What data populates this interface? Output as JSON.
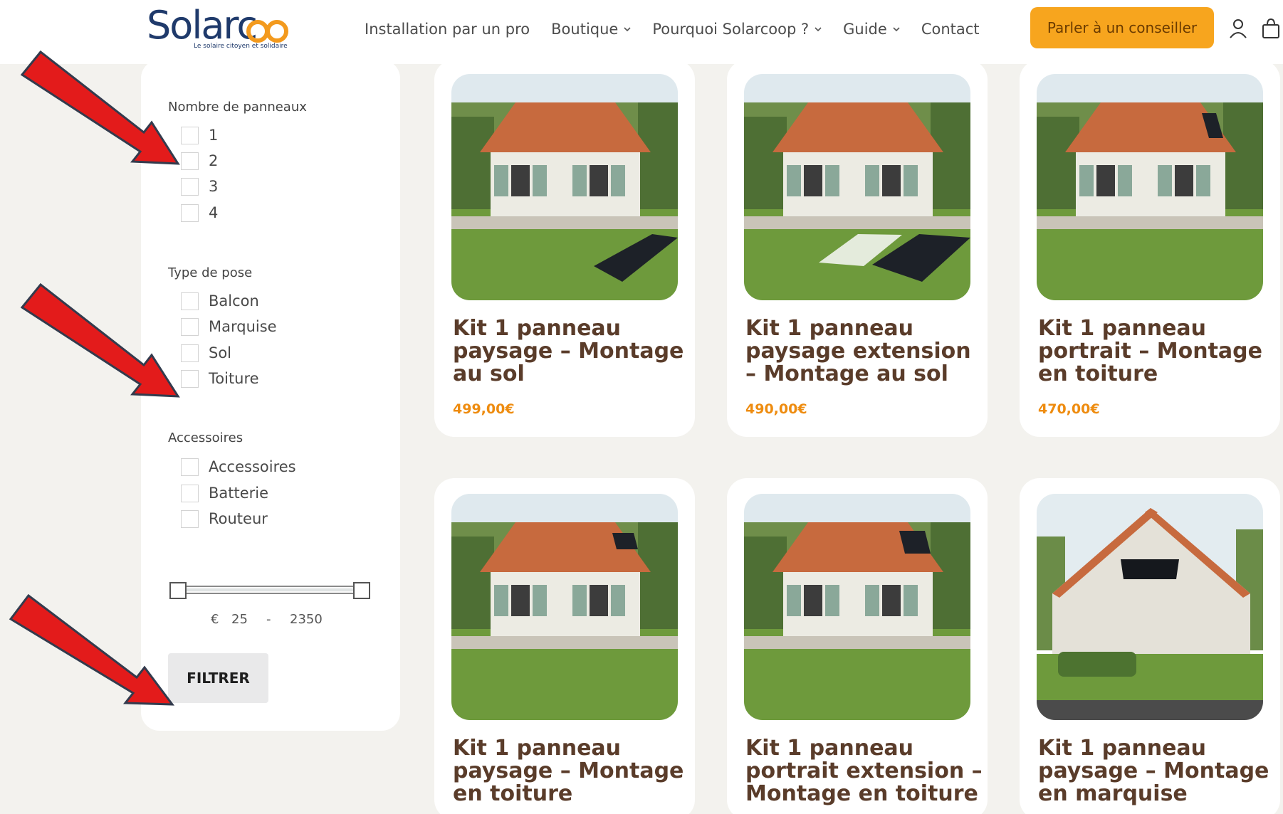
{
  "header": {
    "logo_text": "Solarcoop",
    "logo_tagline": "Le solaire citoyen et solidaire",
    "nav": [
      {
        "label": "Installation par un pro",
        "dropdown": false
      },
      {
        "label": "Boutique",
        "dropdown": true
      },
      {
        "label": "Pourquoi Solarcoop ?",
        "dropdown": true
      },
      {
        "label": "Guide",
        "dropdown": true
      },
      {
        "label": "Contact",
        "dropdown": false
      }
    ],
    "cta_label": "Parler à un conseiller",
    "icons": [
      "user-icon",
      "shopping-bag-icon"
    ],
    "accent_color": "#f7a51e"
  },
  "filters": {
    "panels": {
      "heading": "Nombre de panneaux",
      "options": [
        "1",
        "2",
        "3",
        "4"
      ]
    },
    "pose": {
      "heading": "Type de pose",
      "options": [
        "Balcon",
        "Marquise",
        "Sol",
        "Toiture"
      ]
    },
    "accessories": {
      "heading": "Accessoires",
      "options": [
        "Accessoires",
        "Batterie",
        "Routeur"
      ]
    },
    "price": {
      "currency": "€",
      "min": "25",
      "separator": "-",
      "max": "2350"
    },
    "button_label": "FILTRER"
  },
  "products": [
    {
      "title": "Kit 1 panneau paysage – Montage au sol",
      "price": "499,00€"
    },
    {
      "title": "Kit 1 panneau paysage extension – Montage au sol",
      "price": "490,00€"
    },
    {
      "title": "Kit 1 panneau portrait – Montage en toiture",
      "price": "470,00€"
    },
    {
      "title": "Kit 1 panneau paysage – Montage en toiture",
      "price": ""
    },
    {
      "title": "Kit 1 panneau portrait extension – Montage en toiture",
      "price": ""
    },
    {
      "title": "Kit 1 panneau paysage – Montage en marquise",
      "price": ""
    }
  ],
  "annotations": {
    "arrow_color": "#e31b1b",
    "arrows": [
      "arrow-to-panel-count-2",
      "arrow-to-pose-toiture",
      "arrow-to-filter-button"
    ]
  }
}
